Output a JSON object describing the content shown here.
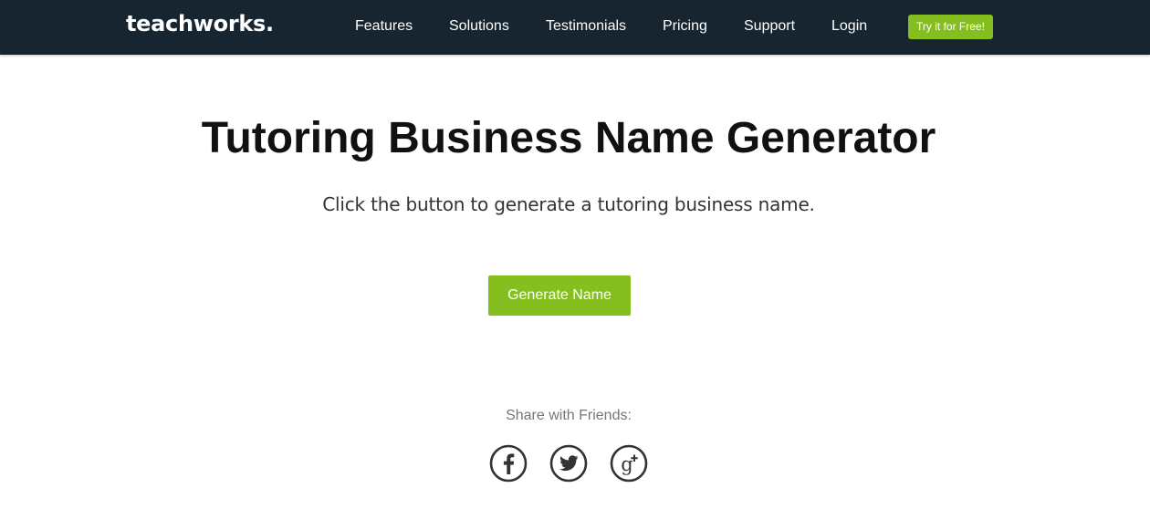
{
  "header": {
    "logo": "teachworks.",
    "nav": [
      "Features",
      "Solutions",
      "Testimonials",
      "Pricing",
      "Support",
      "Login"
    ],
    "cta_label": "Try it for Free!"
  },
  "main": {
    "title": "Tutoring Business Name Generator",
    "subtitle": "Click the button to generate a tutoring business name.",
    "button_label": "Generate Name"
  },
  "share": {
    "label": "Share with Friends:",
    "icons": [
      "facebook-icon",
      "twitter-icon",
      "google-plus-icon"
    ]
  },
  "colors": {
    "header_bg": "#16252f",
    "accent_green": "#85bf1f",
    "icon_dark": "#333333"
  }
}
